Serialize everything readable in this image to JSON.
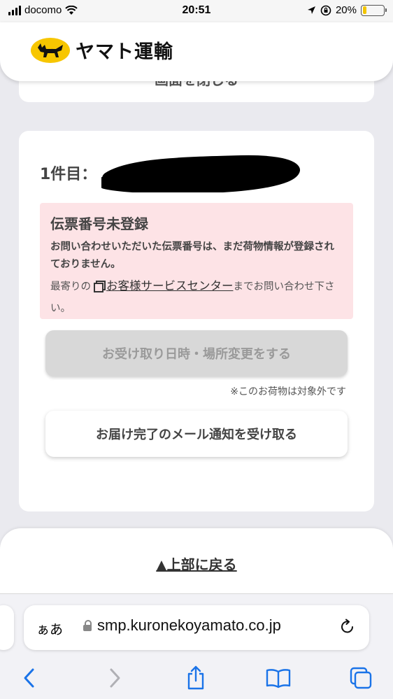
{
  "status": {
    "carrier": "docomo",
    "time": "20:51",
    "battery": "20%",
    "battery_level": 0.2
  },
  "header": {
    "brand": "ヤマト運輸"
  },
  "top_card": {
    "partial_text": "画面を閉じる"
  },
  "shipment": {
    "item_label": "1件目：",
    "alert": {
      "title": "伝票番号未登録",
      "body": "お問い合わせいただいた伝票番号は、まだ荷物情報が登録されておりません。",
      "note_prefix": "最寄りの",
      "link": "お客様サービスセンター",
      "note_suffix": "までお問い合わせ下さい。"
    },
    "change_button": "お受け取り日時・場所変更をする",
    "change_note": "※このお荷物は対象外です",
    "mail_button": "お届け完了のメール通知を受け取る"
  },
  "footer": {
    "back_to_top": "▲上部に戻る"
  },
  "browser": {
    "text_size": "ぁあ",
    "url": "smp.kuronekoyamato.co.jp"
  }
}
